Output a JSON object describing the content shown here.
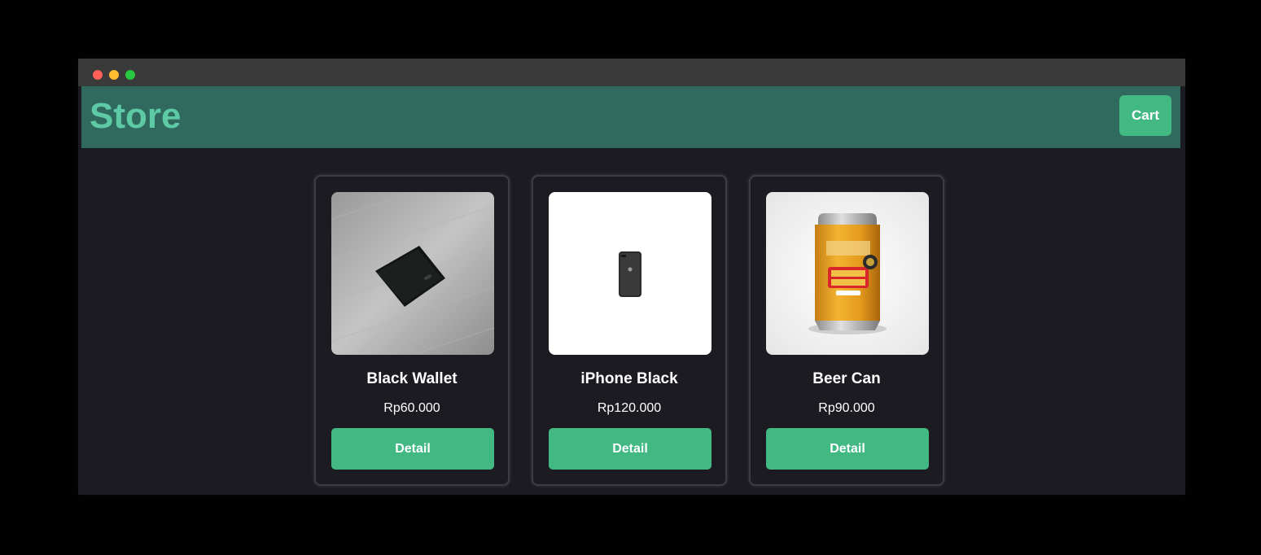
{
  "header": {
    "brand": "Store",
    "cart_label": "Cart"
  },
  "products": [
    {
      "name": "Black Wallet",
      "price": "Rp60.000",
      "button_label": "Detail",
      "image": "black-wallet-photo"
    },
    {
      "name": "iPhone Black",
      "price": "Rp120.000",
      "button_label": "Detail",
      "image": "iphone-black-photo"
    },
    {
      "name": "Beer Can",
      "price": "Rp90.000",
      "button_label": "Detail",
      "image": "ginger-beer-can-photo"
    }
  ],
  "colors": {
    "accent": "#42b883",
    "header_bg": "#306a5e",
    "brand_text": "#5ec9a5",
    "page_bg": "#1c1b21"
  }
}
